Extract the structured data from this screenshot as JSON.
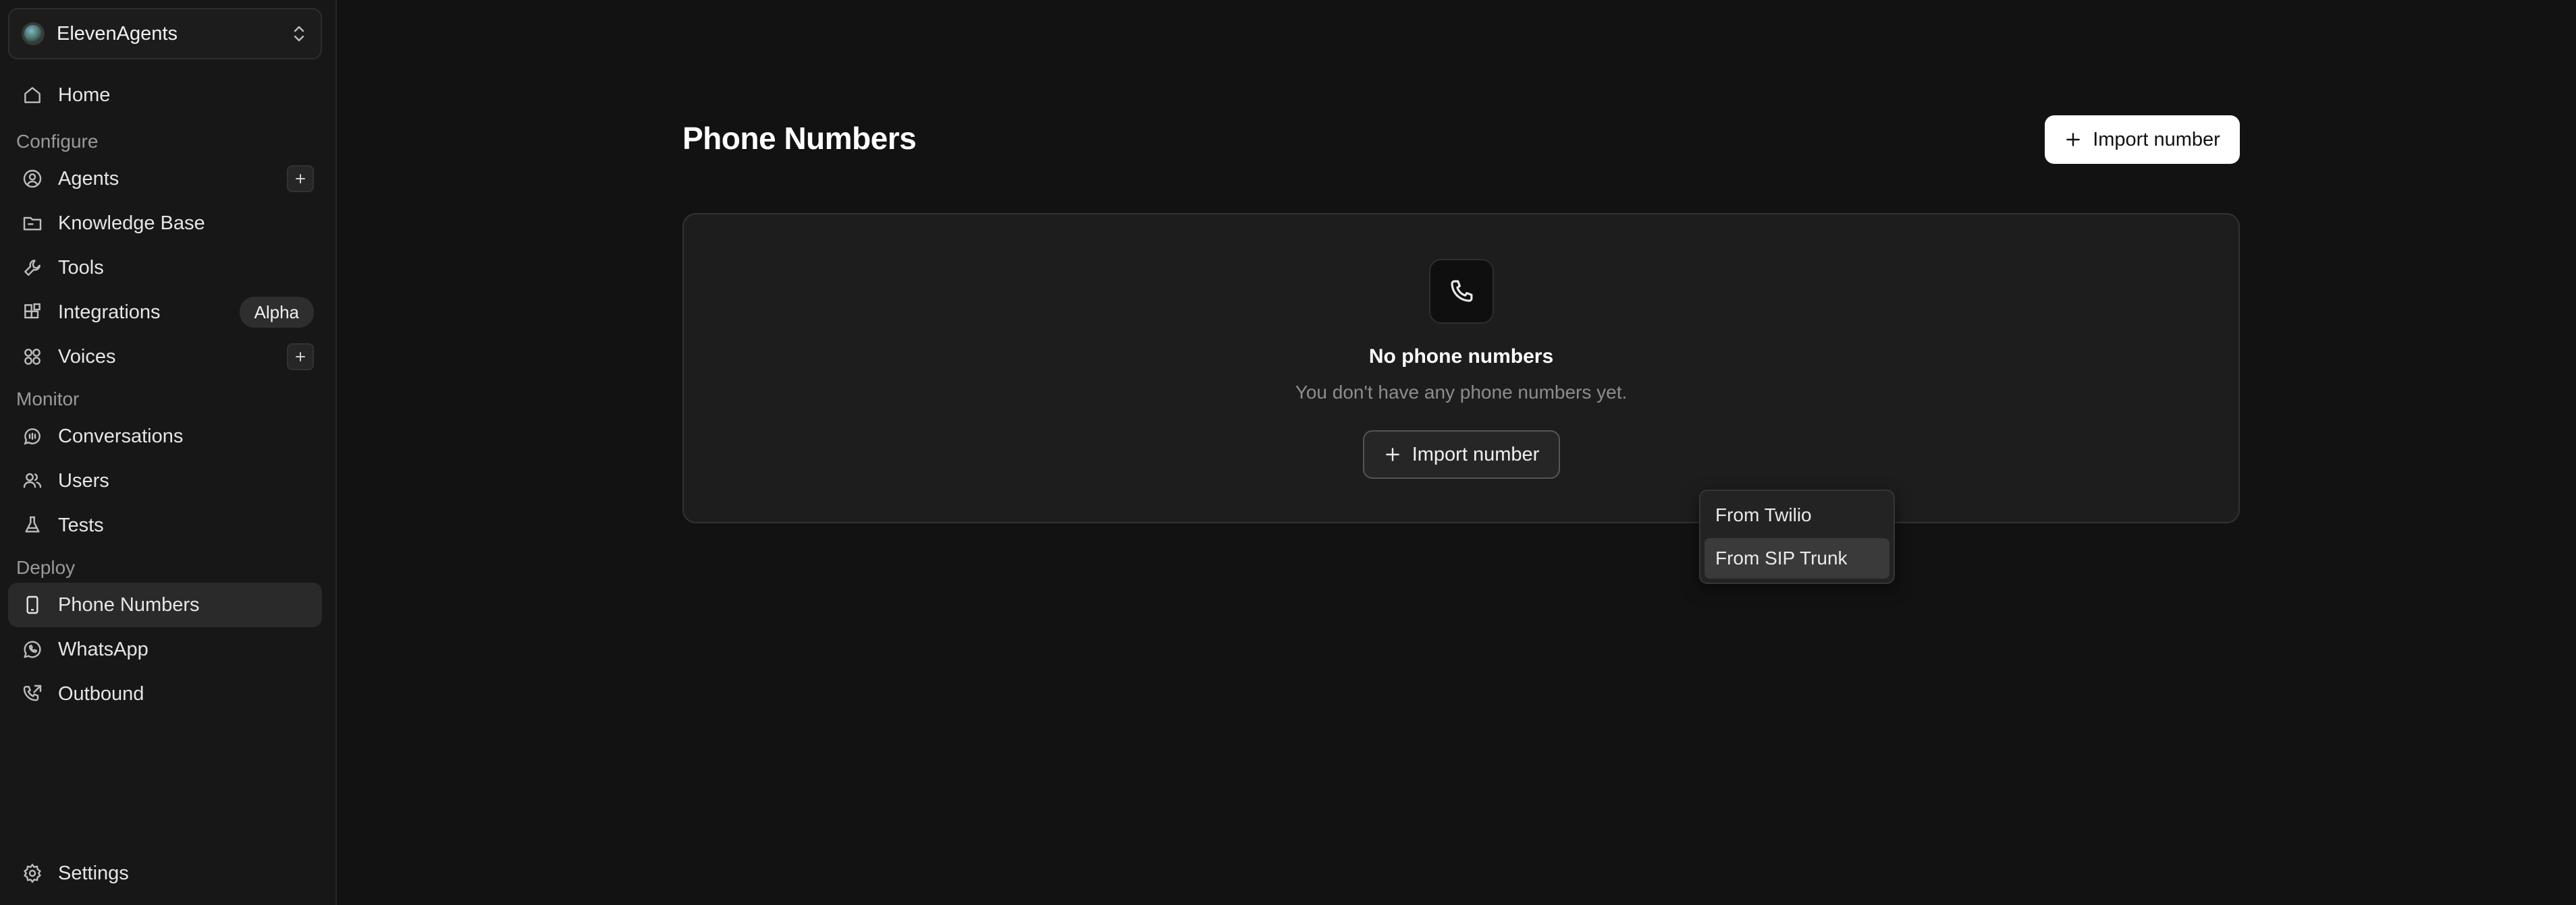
{
  "sidebar": {
    "workspace": {
      "name": "ElevenAgents"
    },
    "home": {
      "label": "Home"
    },
    "sections": {
      "configure": "Configure",
      "monitor": "Monitor",
      "deploy": "Deploy"
    },
    "items": {
      "agents": "Agents",
      "knowledge_base": "Knowledge Base",
      "tools": "Tools",
      "integrations": "Integrations",
      "integrations_badge": "Alpha",
      "voices": "Voices",
      "conversations": "Conversations",
      "users": "Users",
      "tests": "Tests",
      "phone_numbers": "Phone Numbers",
      "whatsapp": "WhatsApp",
      "outbound": "Outbound",
      "settings": "Settings"
    }
  },
  "main": {
    "title": "Phone Numbers",
    "import_button": "Import number",
    "empty": {
      "title": "No phone numbers",
      "subtitle": "You don't have any phone numbers yet.",
      "import_button": "Import number"
    },
    "dropdown": {
      "options": [
        "From Twilio",
        "From SIP Trunk"
      ],
      "highlighted": "From SIP Trunk"
    }
  },
  "colors": {
    "background": "#121212",
    "sidebar": "#171717",
    "card": "#1d1d1d",
    "primary_button": "#ffffff"
  }
}
